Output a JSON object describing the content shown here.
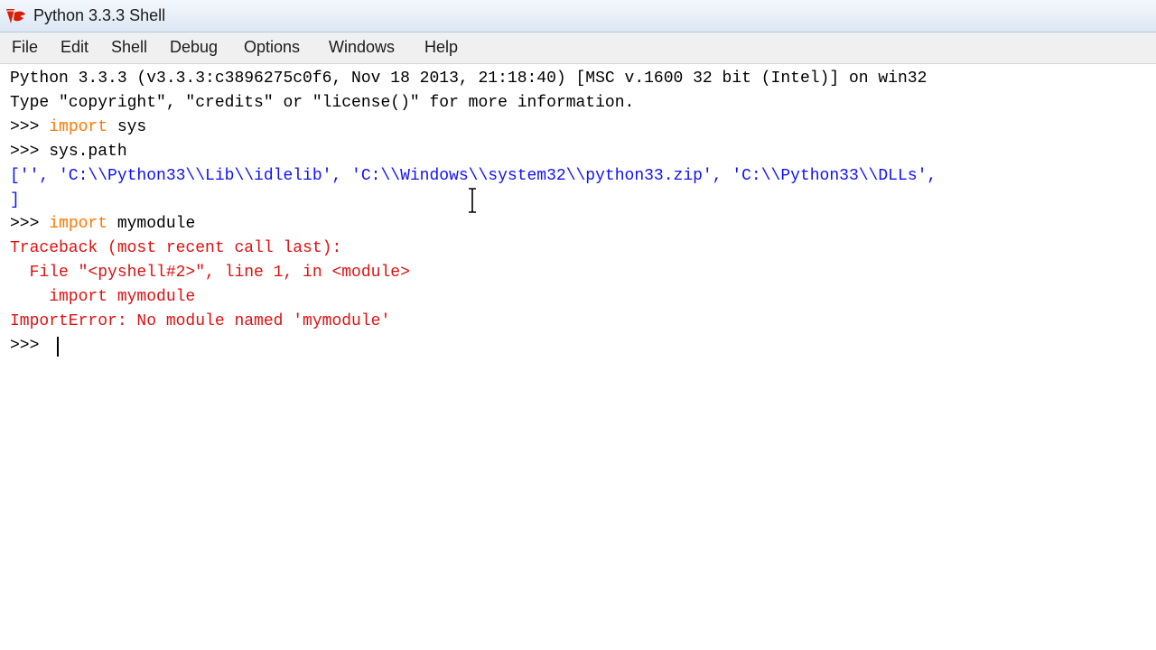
{
  "window": {
    "title": "Python 3.3.3 Shell",
    "logo_icon": "tk-feather-icon"
  },
  "menu": {
    "items": [
      "File",
      "Edit",
      "Shell",
      "Debug",
      "Options",
      "Windows",
      "Help"
    ]
  },
  "shell": {
    "banner_1": "Python 3.3.3 (v3.3.3:c3896275c0f6, Nov 18 2013, 21:18:40) [MSC v.1600 32 bit (Intel)] on win32",
    "banner_2": "Type \"copyright\", \"credits\" or \"license()\" for more information.",
    "prompt": ">>> ",
    "cmd1_keyword": "import",
    "cmd1_rest": " sys",
    "cmd2": "sys.path",
    "output_line_1": "['', 'C:\\\\Python33\\\\Lib\\\\idlelib', 'C:\\\\Windows\\\\system32\\\\python33.zip', 'C:\\\\Python33\\\\DLLs',",
    "output_line_2": "]",
    "cmd3_keyword": "import",
    "cmd3_rest": " mymodule",
    "traceback_1": "Traceback (most recent call last):",
    "traceback_2": "  File \"<pyshell#2>\", line 1, in <module>",
    "traceback_3": "    import mymodule",
    "traceback_4": "ImportError: No module named 'mymodule'",
    "final_prompt": ">>> "
  },
  "colors": {
    "keyword": "#ff7700",
    "output": "#1010ff",
    "error": "#e01010",
    "text": "#000000"
  }
}
